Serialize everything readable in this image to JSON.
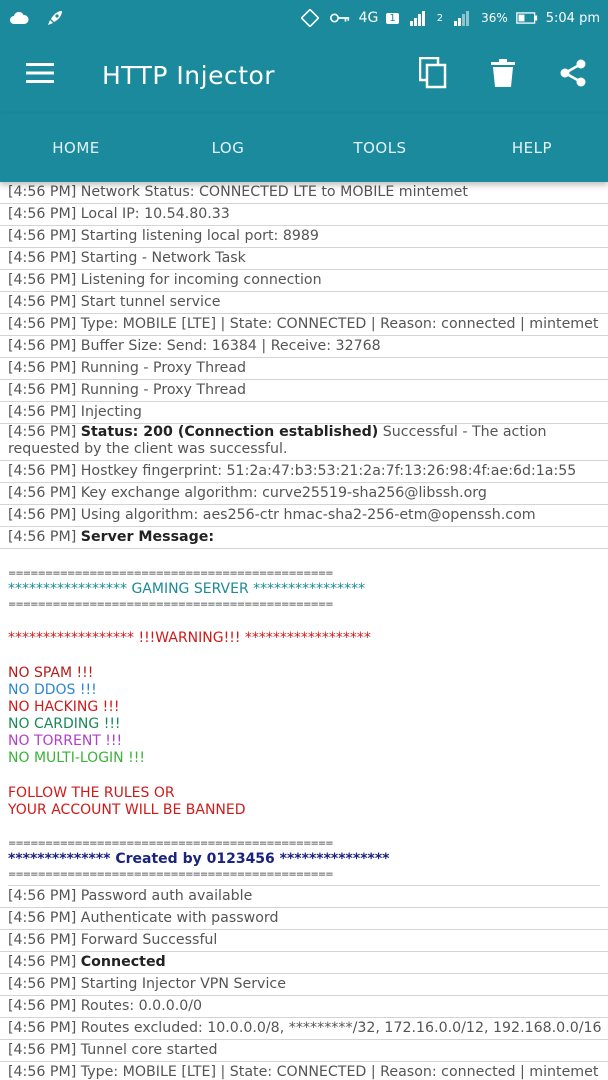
{
  "statusbar": {
    "network": "4G",
    "sim1": "1",
    "sim2": "2",
    "battery": "36%",
    "time": "5:04 pm"
  },
  "appbar": {
    "title": "HTTP Injector",
    "icons": [
      "menu-icon",
      "copy-icon",
      "trash-icon",
      "share-icon"
    ]
  },
  "tabs": [
    {
      "label": "HOME"
    },
    {
      "label": "LOG"
    },
    {
      "label": "TOOLS"
    },
    {
      "label": "HELP"
    }
  ],
  "log": {
    "prefix": "[4:56 PM]",
    "lines_top": [
      "Network Status: CONNECTED LTE to MOBILE mintemet",
      "Local IP: 10.54.80.33",
      "Starting listening local port: 8989",
      "Starting - Network Task",
      "Listening for incoming connection",
      "Start tunnel service",
      "Type: MOBILE [LTE] | State: CONNECTED | Reason: connected | mintemet",
      "Buffer Size: Send: 16384 | Receive: 32768",
      "Running - Proxy Thread",
      "Running - Proxy Thread",
      "Injecting"
    ],
    "status_bold": "Status: 200 (Connection established)",
    "status_rest": " Successful - The action requested by the client was successful.",
    "lines_mid": [
      "Hostkey fingerprint: 51:2a:47:b3:53:21:2a:7f:13:26:98:4f:ae:6d:1a:55",
      "Key exchange algorithm: curve25519-sha256@libssh.org",
      "Using algorithm: aes256-ctr hmac-sha2-256-etm@openssh.com"
    ],
    "server_message_label": "Server Message:",
    "server_message": {
      "rule": "============================================",
      "gaming": "***************** GAMING SERVER ****************",
      "warning": "****************** !!!WARNING!!! ******************",
      "rules": [
        "NO SPAM !!!",
        "NO DDOS !!!",
        "NO HACKING !!!",
        "NO CARDING !!!",
        "NO TORRENT !!!",
        "NO MULTI-LOGIN !!!"
      ],
      "follow1": "FOLLOW THE RULES OR",
      "follow2": "YOUR ACCOUNT WILL BE BANNED",
      "created": "************** Created by 0123456 ***************"
    },
    "lines_after": [
      "Password auth available",
      "Authenticate with password",
      "Forward Successful"
    ],
    "connected": "Connected",
    "lines_bottom": [
      "Starting Injector VPN Service",
      "Routes: 0.0.0.0/0",
      "Routes excluded: 10.0.0.0/8, *********/32, 172.16.0.0/12, 192.168.0.0/16",
      "Tunnel core started",
      "Type: MOBILE [LTE] | State: CONNECTED | Reason: connected | mintemet"
    ]
  },
  "colors": {
    "primary": "#1a8a9c",
    "teal_text": "#1b8a96",
    "red_text": "#d01a1a",
    "navy_text": "#1a237e"
  }
}
